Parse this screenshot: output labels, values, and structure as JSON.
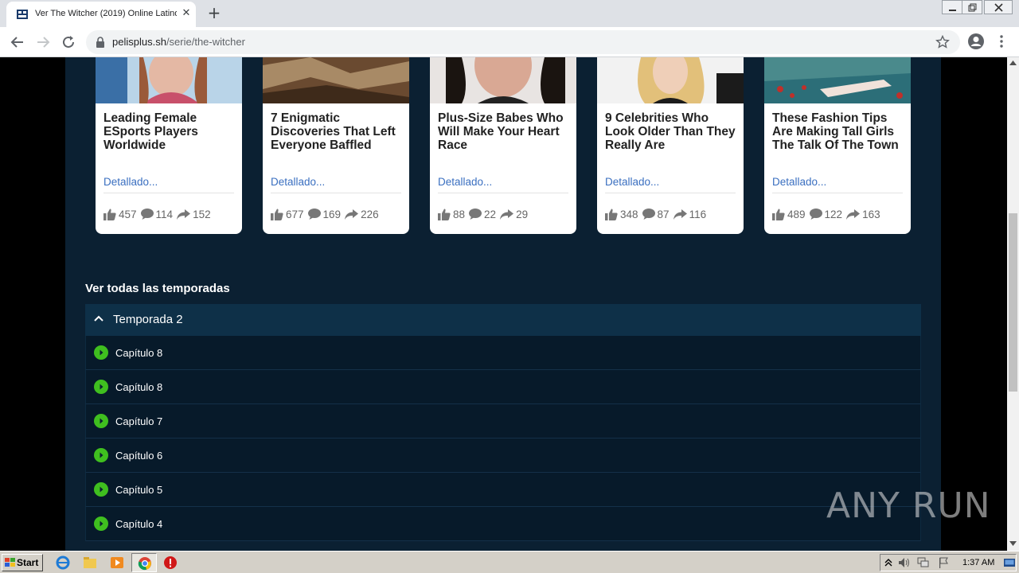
{
  "browser": {
    "tab_title": "Ver The Witcher (2019) Online Latino",
    "url_domain": "pelisplus.sh",
    "url_path": "/serie/the-witcher"
  },
  "cards": [
    {
      "title": "Leading Female ESports Players Worldwide",
      "link": "Detallado...",
      "likes": "457",
      "comments": "114",
      "shares": "152"
    },
    {
      "title": "7 Enigmatic Discoveries That Left Everyone Baffled",
      "link": "Detallado...",
      "likes": "677",
      "comments": "169",
      "shares": "226"
    },
    {
      "title": "Plus-Size Babes Who Will Make Your Heart Race",
      "link": "Detallado...",
      "likes": "88",
      "comments": "22",
      "shares": "29"
    },
    {
      "title": "9 Celebrities Who Look Older Than They Really Are",
      "link": "Detallado...",
      "likes": "348",
      "comments": "87",
      "shares": "116"
    },
    {
      "title": "These Fashion Tips Are Making Tall Girls The Talk Of The Town",
      "link": "Detallado...",
      "likes": "489",
      "comments": "122",
      "shares": "163"
    }
  ],
  "seasons": {
    "heading": "Ver todas las temporadas",
    "current": "Temporada 2",
    "episodes": [
      "Capítulo 8",
      "Capítulo 8",
      "Capítulo 7",
      "Capítulo 6",
      "Capítulo 5",
      "Capítulo 4"
    ]
  },
  "watermark": "ANY RUN",
  "taskbar": {
    "start_label": "Start",
    "clock": "1:37 AM"
  },
  "colors": {
    "page_bg": "#0b2032",
    "season_header": "#0e3048",
    "play_icon": "#3fbf1f",
    "link": "#3a6fc0"
  }
}
